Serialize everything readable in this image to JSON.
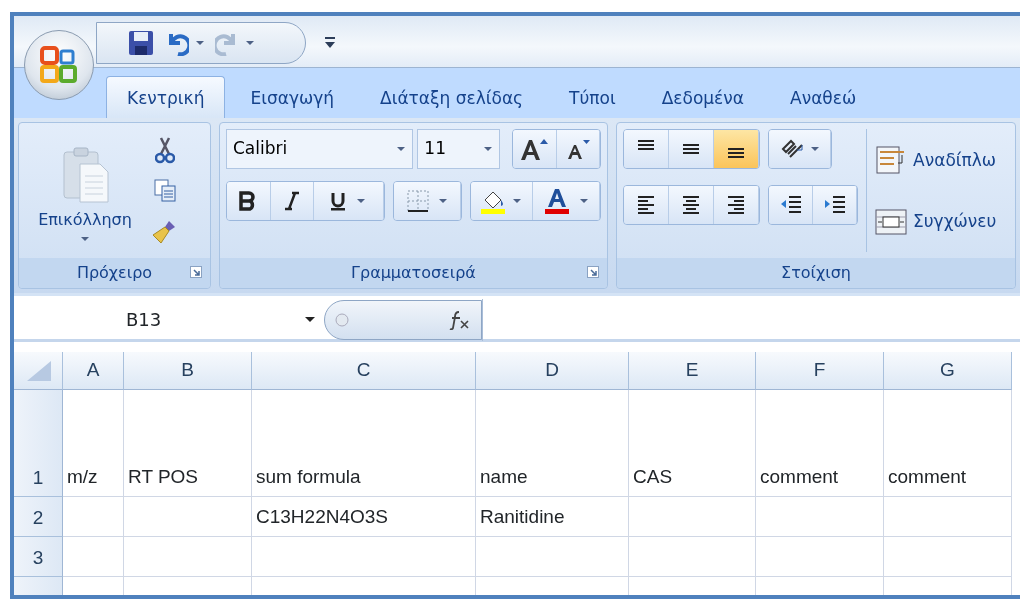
{
  "tabs": [
    {
      "label": "Κεντρική",
      "selected": true
    },
    {
      "label": "Εισαγωγή",
      "selected": false
    },
    {
      "label": "Διάταξη σελίδας",
      "selected": false
    },
    {
      "label": "Τύποι",
      "selected": false
    },
    {
      "label": "Δεδομένα",
      "selected": false
    },
    {
      "label": "Αναθεώ",
      "selected": false
    }
  ],
  "ribbon": {
    "clipboard": {
      "paste_label": "Επικόλληση",
      "title": "Πρόχειρο"
    },
    "font": {
      "font_name": "Calibri",
      "font_size": "11",
      "title": "Γραμματοσειρά"
    },
    "alignment": {
      "vertical_align": [
        {
          "selected": false
        },
        {
          "selected": false
        },
        {
          "selected": true
        }
      ],
      "horizontal_align": [
        {
          "selected": false
        },
        {
          "selected": false
        },
        {
          "selected": false
        }
      ],
      "wrap_text": "Αναδίπλω",
      "merge": "Συγχώνευ",
      "title": "Στοίχιση"
    }
  },
  "name_box": "B13",
  "columns": [
    "A",
    "B",
    "C",
    "D",
    "E",
    "F",
    "G"
  ],
  "rows": [
    {
      "number": "1",
      "cells": [
        "m/z",
        "RT POS",
        "sum formula",
        "name",
        "CAS",
        "comment",
        "comment"
      ]
    },
    {
      "number": "2",
      "cells": [
        "",
        "",
        "C13H22N4O3S",
        "Ranitidine",
        "",
        "",
        ""
      ]
    },
    {
      "number": "3",
      "cells": [
        "",
        "",
        "",
        "",
        "",
        "",
        ""
      ]
    }
  ]
}
